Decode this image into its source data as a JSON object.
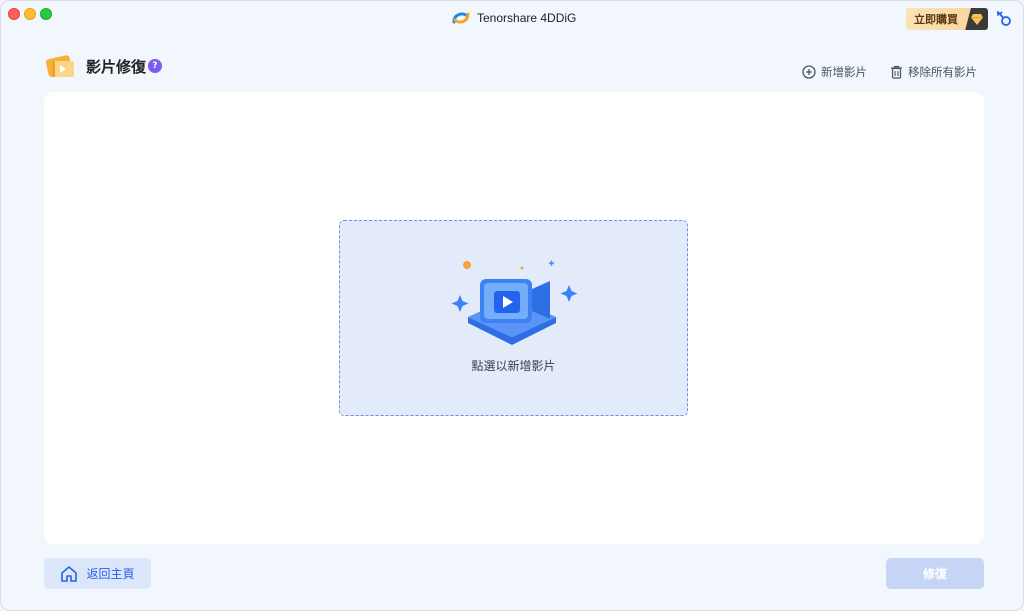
{
  "app": {
    "title": "Tenorshare 4DDiG",
    "buy_label": "立即購買"
  },
  "header": {
    "title": "影片修復",
    "help_label": "?",
    "add_video_label": "新增影片",
    "remove_all_label": "移除所有影片"
  },
  "dropzone": {
    "label": "點選以新增影片"
  },
  "footer": {
    "back_label": "返回主頁",
    "repair_label": "修復"
  },
  "colors": {
    "accent": "#2563eb",
    "dropzone_border": "#6b8ff0",
    "dropzone_bg": "#e3ebfb",
    "buy_gradient_start": "#fbe3b6",
    "help_badge": "#7b5cf5"
  },
  "icons": [
    "app-logo-icon",
    "diamond-icon",
    "key-icon",
    "video-repair-icon",
    "plus-circle-icon",
    "trash-icon",
    "video-camera-icon",
    "home-icon"
  ]
}
